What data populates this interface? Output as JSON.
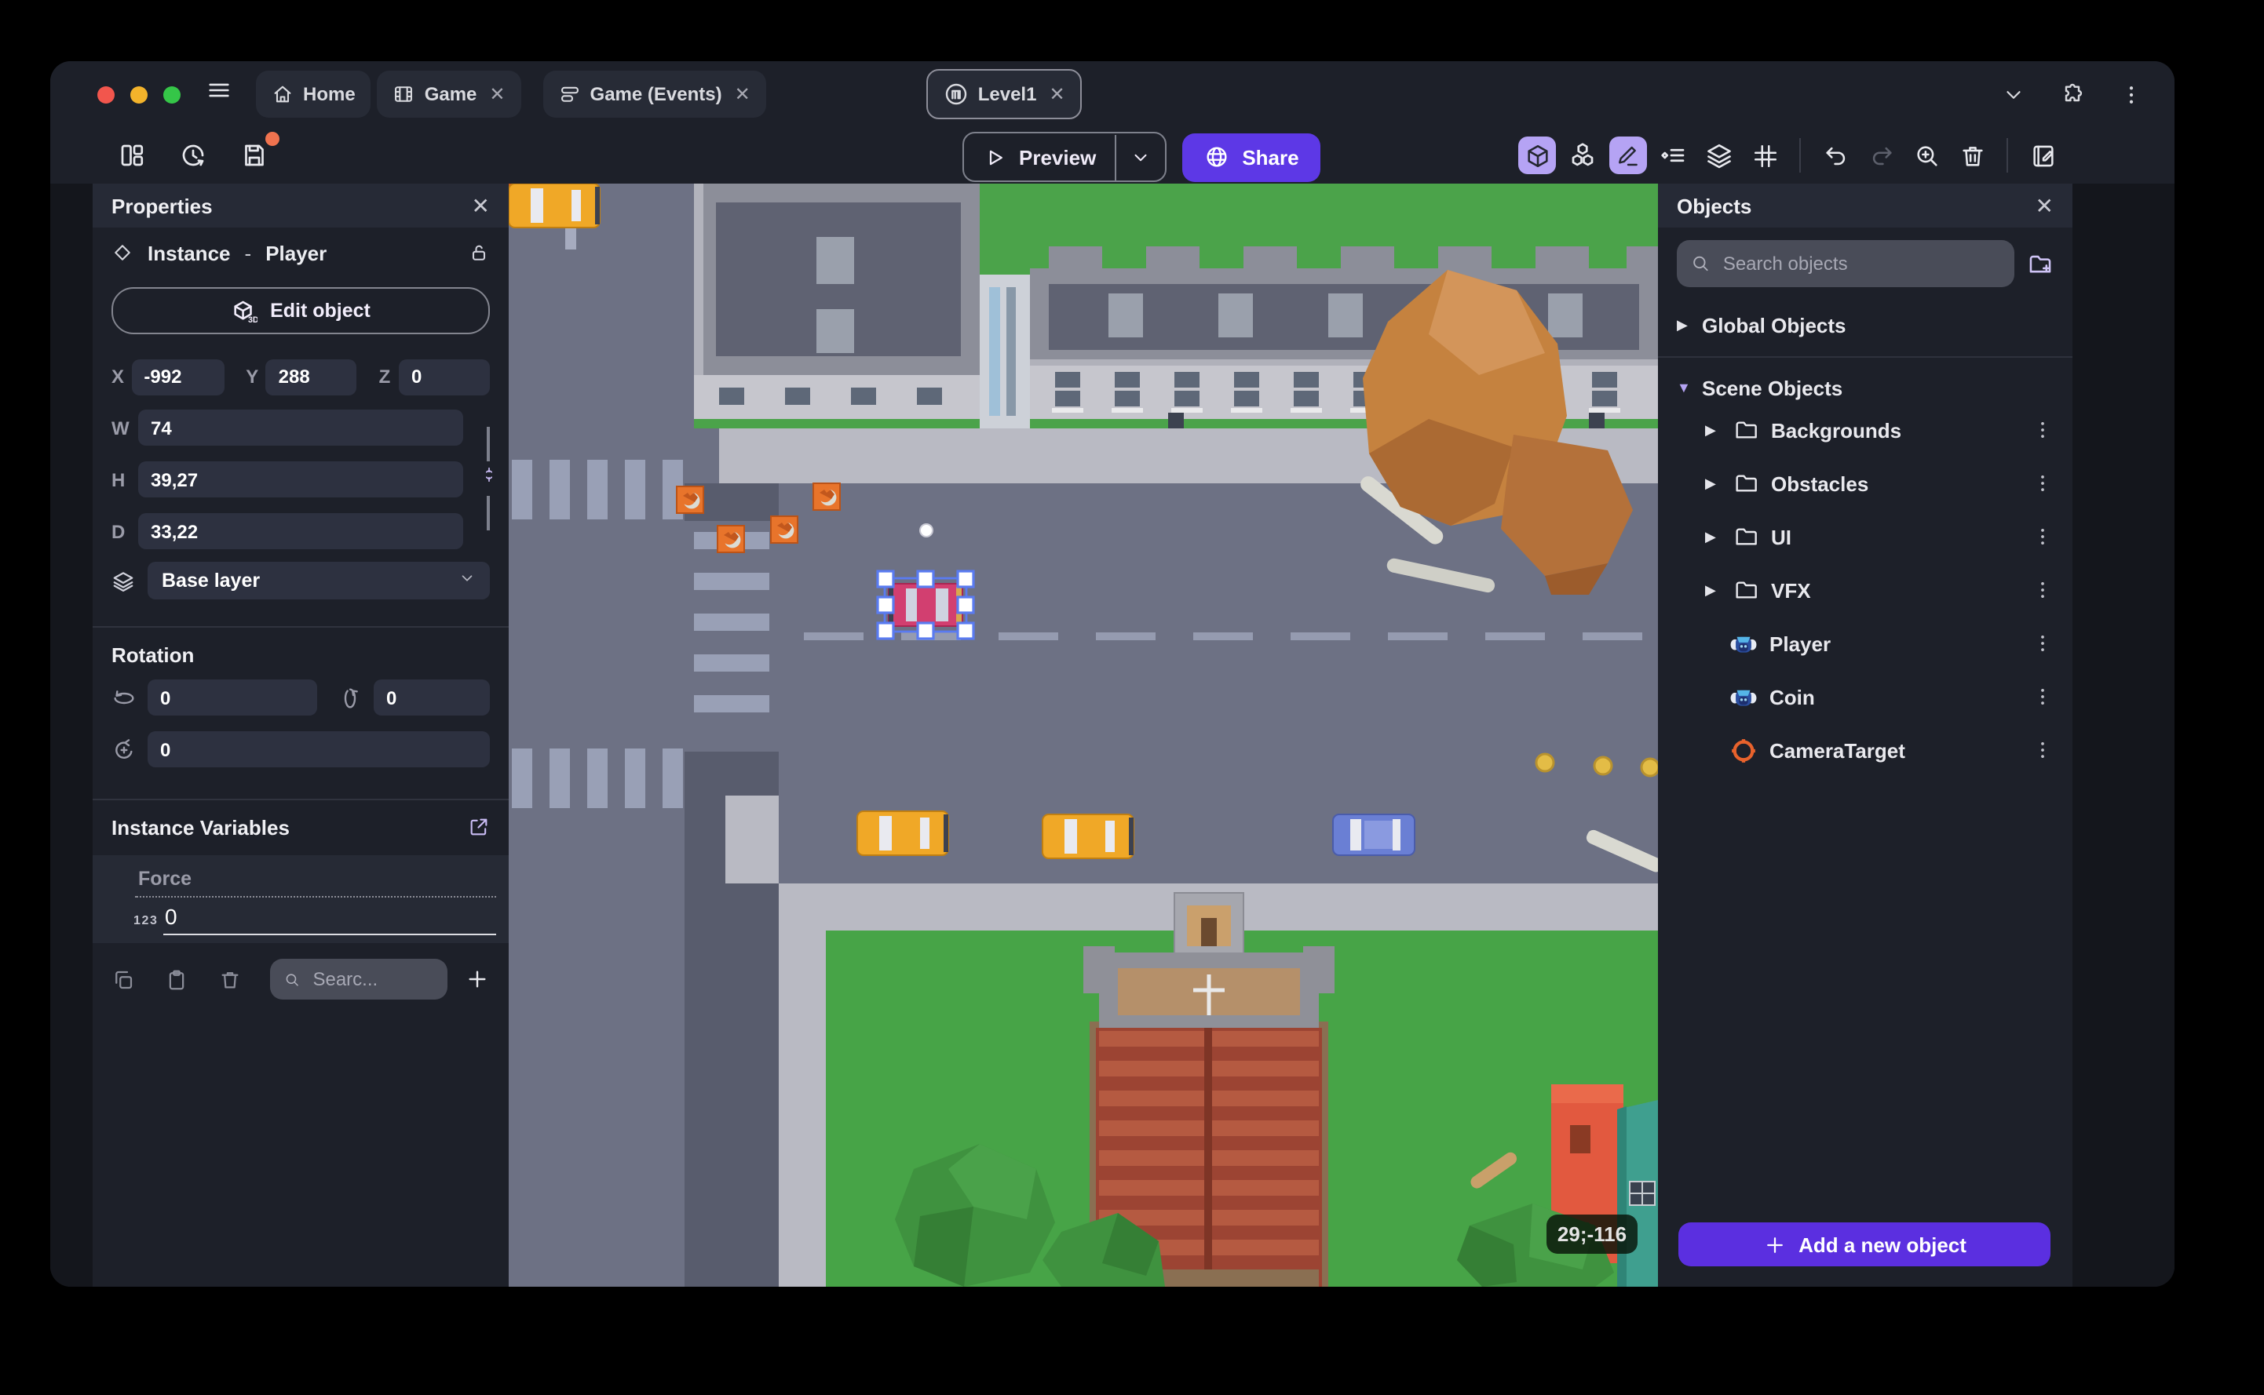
{
  "theme": {
    "accent_purple": "#5b2fe0",
    "share_purple": "#5d38e6",
    "toolbar_active_bg": "#b5a3f4",
    "unsaved_dot": "#f0734f",
    "panel_bg": "#1d2029",
    "panel_header_bg": "#262a36",
    "field_bg": "#2d3140",
    "pill_bg": "#494c58",
    "text_muted": "#9a9ba8",
    "mac_red": "#f2564d",
    "mac_yellow": "#f3b32b",
    "mac_green": "#35c648",
    "selection_blue": "#5a7bf0"
  },
  "titlebar": {
    "tabs": [
      {
        "label": "Home"
      },
      {
        "label": "Game"
      },
      {
        "label": "Game (Events)"
      },
      {
        "label": "Level1"
      }
    ]
  },
  "toolbar": {
    "preview_label": "Preview",
    "share_label": "Share"
  },
  "properties_panel": {
    "title": "Properties",
    "instance_label": "Instance",
    "separator": "-",
    "instance_name": "Player",
    "edit_object_label": "Edit object",
    "edit_object_badge": "3D",
    "x_label": "X",
    "x_value": "-992",
    "y_label": "Y",
    "y_value": "288",
    "z_label": "Z",
    "z_value": "0",
    "w_label": "W",
    "w_value": "74",
    "h_label": "H",
    "h_value": "39,27",
    "d_label": "D",
    "d_value": "33,22",
    "layer_value": "Base layer",
    "rotation_title": "Rotation",
    "rotation_x": "0",
    "rotation_y": "0",
    "rotation_z": "0",
    "instance_variables_title": "Instance Variables",
    "variable_name": "Force",
    "variable_type_badge": "123",
    "variable_value": "0",
    "variables_search_placeholder": "Searc..."
  },
  "objects_panel": {
    "title": "Objects",
    "search_placeholder": "Search objects",
    "global_group_label": "Global Objects",
    "scene_group_label": "Scene Objects",
    "items": [
      {
        "label": "Backgrounds",
        "type": "folder"
      },
      {
        "label": "Obstacles",
        "type": "folder"
      },
      {
        "label": "UI",
        "type": "folder"
      },
      {
        "label": "VFX",
        "type": "folder"
      },
      {
        "label": "Player",
        "type": "sprite"
      },
      {
        "label": "Coin",
        "type": "sprite"
      },
      {
        "label": "CameraTarget",
        "type": "camera-target"
      }
    ],
    "add_button_label": "Add a new object"
  },
  "canvas": {
    "coordinates_badge": "29;-116"
  },
  "icons": {
    "hamburger": "menu lines",
    "home": "house",
    "game_tab": "film strip",
    "events_tab": "event sheet rows",
    "scene_tab": "circled building",
    "chevron_down": "v caret",
    "extensions": "puzzle piece",
    "browser_menu": "kebab dots",
    "panels": "dashboard layout",
    "history": "clock arrow",
    "save": "floppy disk + orange unsaved dot",
    "preview": "play triangle",
    "share": "globe",
    "view_3d": "cube (active)",
    "object_stack": "stacked cubes",
    "edit_mode": "pencil (active)",
    "instances_list": "diamond list",
    "layers": "stacked layers",
    "grid": "hash grid",
    "undo": "arrow left curve",
    "redo": "arrow right curve (disabled)",
    "zoom_in": "magnifier plus",
    "delete": "trash can",
    "scene_notes": "notebook pencil",
    "properties_instance": "diamond outline",
    "unlocked": "open padlock",
    "link_dimensions": "chain link",
    "rotation_x": "arc arrow",
    "rotation_y": "arc arrow vertical",
    "rotation_z": "circular arrow plus",
    "external_link": "arrow out of box",
    "copy": "double square",
    "paste": "clipboard",
    "trash_small": "trash",
    "search": "magnifier",
    "plus": "plus",
    "folder": "folder outline",
    "new_folder": "folder plus",
    "sprite": "blue monkey head",
    "camera_target": "orange crosshair"
  }
}
